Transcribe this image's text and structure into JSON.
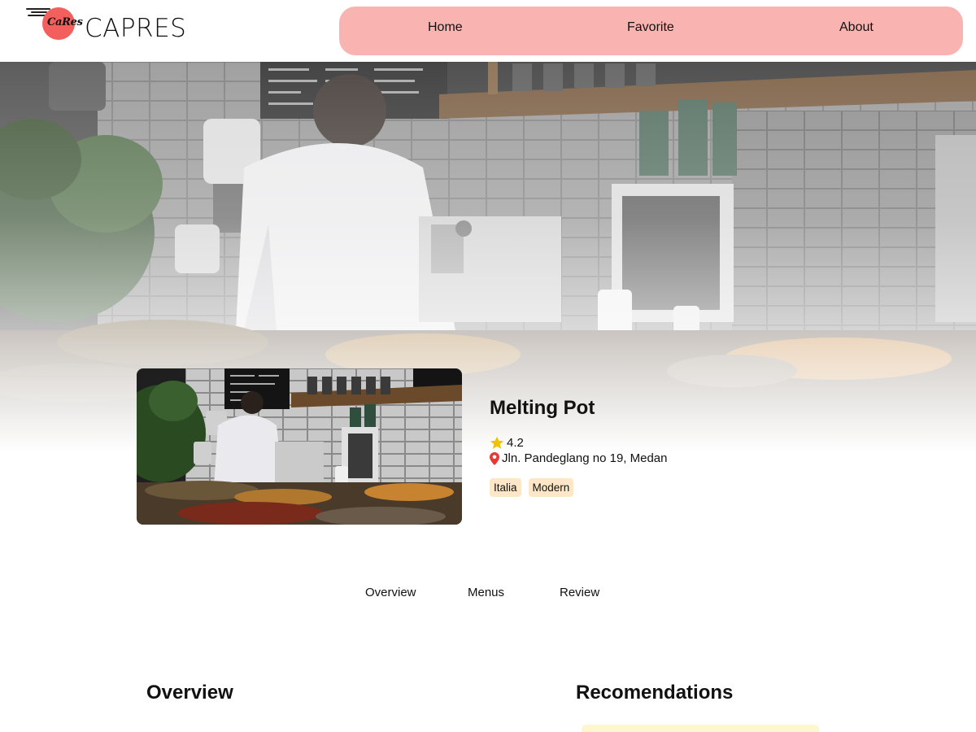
{
  "brand": {
    "name": "CAPRES",
    "mark": "CaRes",
    "accent": "#f25f5c",
    "nav_color": "#f9b4b1"
  },
  "nav": {
    "home": "Home",
    "favorite": "Favorite",
    "about": "About"
  },
  "restaurant": {
    "name": "Melting Pot",
    "rating": "4.2",
    "address": "Jln. Pandeglang no 19, Medan",
    "tags": [
      "Italia",
      "Modern"
    ],
    "star_color": "#f2c200",
    "pin_color": "#e53935",
    "tag_color": "#fde7c6"
  },
  "tabs": {
    "overview": "Overview",
    "menus": "Menus",
    "review": "Review"
  },
  "sections": {
    "overview_title": "Overview",
    "recommendations_title": "Recomendations"
  }
}
